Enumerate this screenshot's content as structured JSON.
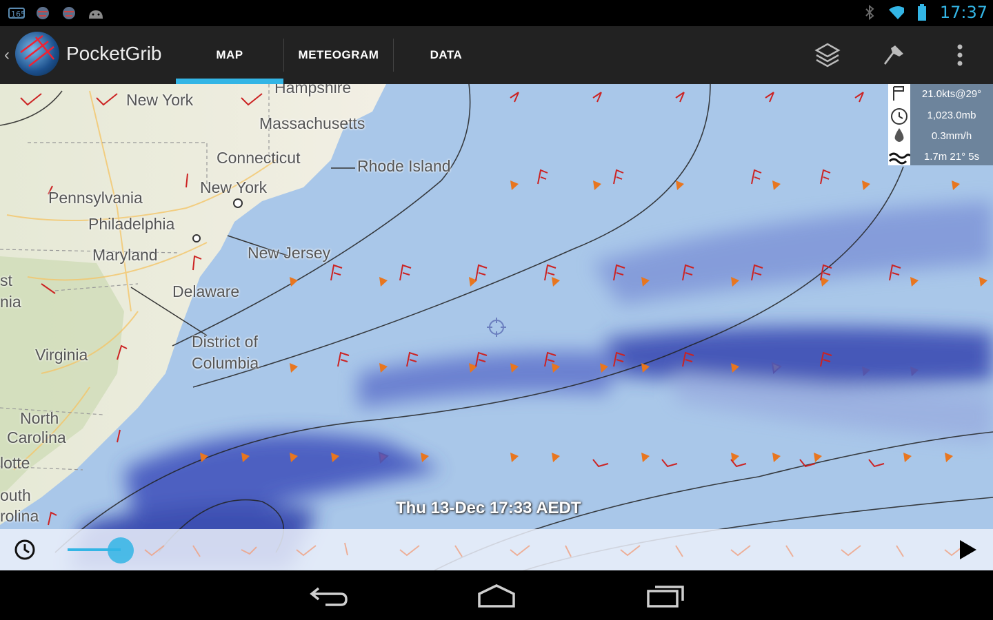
{
  "status_bar": {
    "time": "17:37",
    "left_icons": [
      "notification-icon-1",
      "globe-icon",
      "globe-icon-2",
      "android-icon"
    ],
    "right_icons": [
      "bluetooth-icon",
      "wifi-icon",
      "battery-icon"
    ]
  },
  "action_bar": {
    "app_title": "PocketGrib",
    "tabs": [
      {
        "label": "MAP",
        "selected": true
      },
      {
        "label": "METEOGRAM",
        "selected": false
      },
      {
        "label": "DATA",
        "selected": false
      }
    ],
    "actions": [
      "layers-icon",
      "pin-icon",
      "overflow-menu-icon"
    ],
    "accent_color": "#33b5e5"
  },
  "map": {
    "labels": [
      "Hampshire",
      "New York",
      "Massachusetts",
      "Connecticut",
      "Rhode Island",
      "New York",
      "Pennsylvania",
      "Philadelphia",
      "Maryland",
      "New Jersey",
      "Delaware",
      "District of",
      "Columbia",
      "Virginia",
      "North",
      "Carolina",
      "st",
      "nia",
      "lotte",
      "outh",
      "rolina"
    ],
    "info_panel": {
      "wind": "21.0kts@29°",
      "pressure": "1,023.0mb",
      "precipitation": "0.3mm/h",
      "waves": "1.7m 21° 5s"
    },
    "timestamp": "Thu 13-Dec 17:33 AEDT"
  },
  "timeline": {
    "progress": 0.06
  },
  "nav_bar": {
    "buttons": [
      "back-icon",
      "home-icon",
      "recent-apps-icon"
    ]
  }
}
